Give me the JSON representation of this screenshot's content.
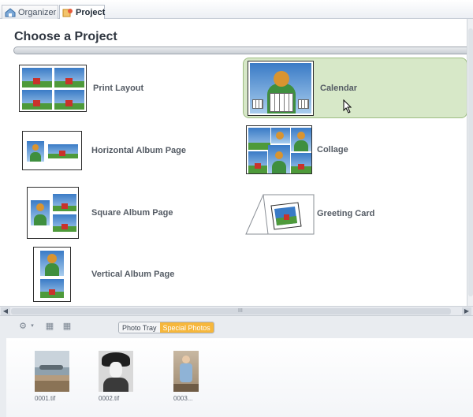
{
  "tabs": [
    {
      "label": "Organizer",
      "icon": "organizer-icon"
    },
    {
      "label": "Project",
      "icon": "project-icon"
    }
  ],
  "main": {
    "title": "Choose a Project",
    "items": [
      {
        "label": "Print Layout",
        "icon": "print-layout-icon"
      },
      {
        "label": "Calendar",
        "icon": "calendar-icon",
        "selected": true
      },
      {
        "label": "Horizontal Album Page",
        "icon": "horizontal-album-icon"
      },
      {
        "label": "Collage",
        "icon": "collage-icon"
      },
      {
        "label": "Square Album Page",
        "icon": "square-album-icon"
      },
      {
        "label": "Greeting Card",
        "icon": "greeting-card-icon"
      },
      {
        "label": "Vertical Album Page",
        "icon": "vertical-album-icon"
      }
    ]
  },
  "scrollbar_h": {
    "grip": "III"
  },
  "tray": {
    "tabs": [
      "Photo Tray",
      "Special Photos"
    ],
    "photos": [
      {
        "caption": "0001.tif"
      },
      {
        "caption": "0002.tif"
      },
      {
        "caption": "0003..."
      }
    ]
  },
  "colors": {
    "selected_bg": "#d7e8c8",
    "selected_border": "#9ebd83",
    "special_tab": "#f6b73c"
  }
}
